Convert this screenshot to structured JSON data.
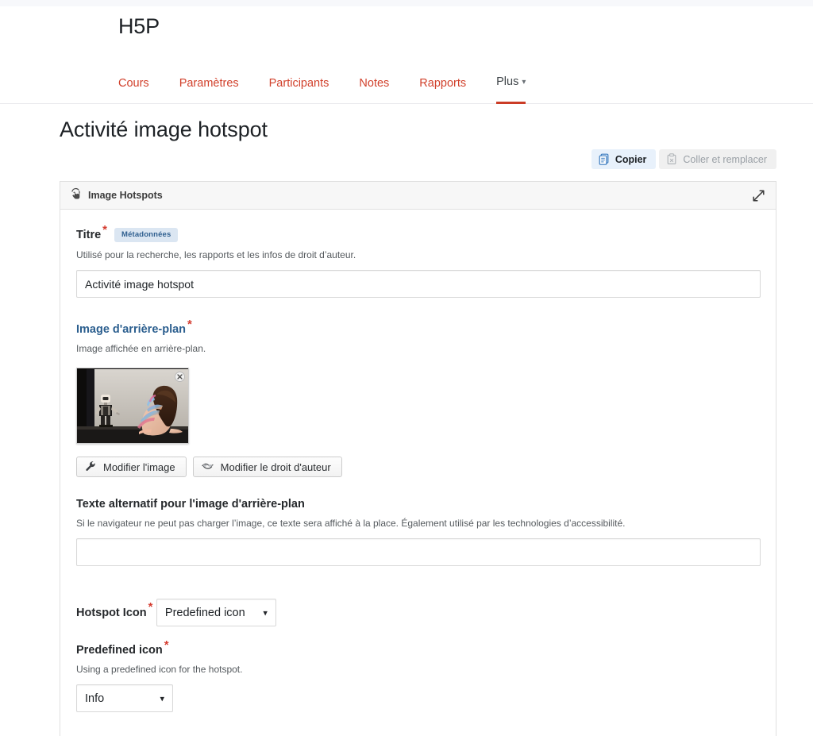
{
  "header": {
    "brand": "H5P",
    "tabs": [
      {
        "label": "Cours",
        "active": false
      },
      {
        "label": "Paramètres",
        "active": false
      },
      {
        "label": "Participants",
        "active": false
      },
      {
        "label": "Notes",
        "active": false
      },
      {
        "label": "Rapports",
        "active": false
      },
      {
        "label": "Plus",
        "active": true,
        "has_caret": true
      }
    ]
  },
  "page_title": "Activité image hotspot",
  "clipboard": {
    "copy_label": "Copier",
    "copy_icon": "clipboard-copy-icon",
    "paste_label": "Coller et remplacer",
    "paste_icon": "clipboard-paste-icon"
  },
  "panel": {
    "icon": "hotspot-icon",
    "title": "Image Hotspots",
    "expand_icon": "expand-diagonal-icon"
  },
  "form": {
    "title_field": {
      "label": "Titre",
      "required": true,
      "badge": "Métadonnées",
      "description": "Utilisé pour la recherche, les rapports et les infos de droit d’auteur.",
      "value": "Activité image hotspot",
      "placeholder": ""
    },
    "background_image": {
      "label": "Image d'arrière-plan",
      "required": true,
      "description": "Image affichée en arrière-plan.",
      "remove_icon": "close-circle-icon",
      "edit_image_button": {
        "label": "Modifier l'image",
        "icon": "wrench-icon"
      },
      "edit_copyright_button": {
        "label": "Modifier le droit d'auteur",
        "icon": "copyright-handshake-icon"
      }
    },
    "alt_text": {
      "label": "Texte alternatif pour l'image d'arrière-plan",
      "required": false,
      "description": "Si le navigateur ne peut pas charger l’image, ce texte sera affiché à la place. Également utilisé par les technologies d’accessibilité.",
      "value": "",
      "placeholder": ""
    },
    "hotspot_icon": {
      "label": "Hotspot Icon",
      "required": true,
      "selected": "Predefined icon",
      "options": [
        "Predefined icon"
      ]
    },
    "predefined_icon": {
      "label": "Predefined icon",
      "required": true,
      "description": "Using a predefined icon for the hotspot.",
      "selected": "Info",
      "options": [
        "Info"
      ]
    }
  },
  "colors": {
    "accent_red": "#d1402b",
    "active_underline": "#cb3c26",
    "required_star": "#d43b2f",
    "badge_bg": "#dbe6f2",
    "badge_text": "#2f5f8f",
    "link_heading": "#2c5f8f",
    "copy_btn_bg": "#e8f1fb"
  }
}
